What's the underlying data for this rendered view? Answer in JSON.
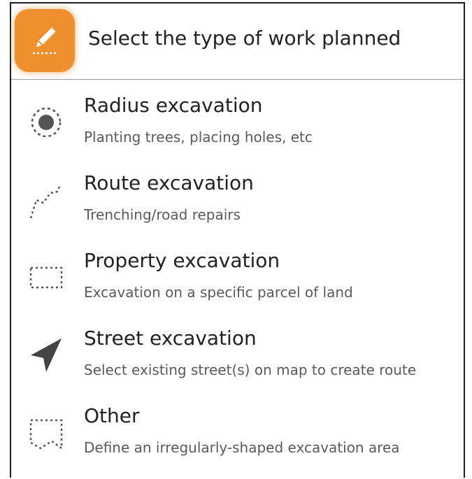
{
  "header": {
    "title": "Select the type of work planned",
    "icon": "pencil-edit-icon",
    "icon_color": "#ef8f2d"
  },
  "options": [
    {
      "title": "Radius excavation",
      "description": "Planting trees, placing holes, etc",
      "icon": "radius-icon"
    },
    {
      "title": "Route excavation",
      "description": "Trenching/road repairs",
      "icon": "route-icon"
    },
    {
      "title": "Property excavation",
      "description": "Excavation on a specific parcel of land",
      "icon": "property-icon"
    },
    {
      "title": "Street excavation",
      "description": "Select existing street(s) on map to create route",
      "icon": "street-arrow-icon"
    },
    {
      "title": "Other",
      "description": "Define an irregularly-shaped excavation area",
      "icon": "irregular-area-icon"
    }
  ]
}
